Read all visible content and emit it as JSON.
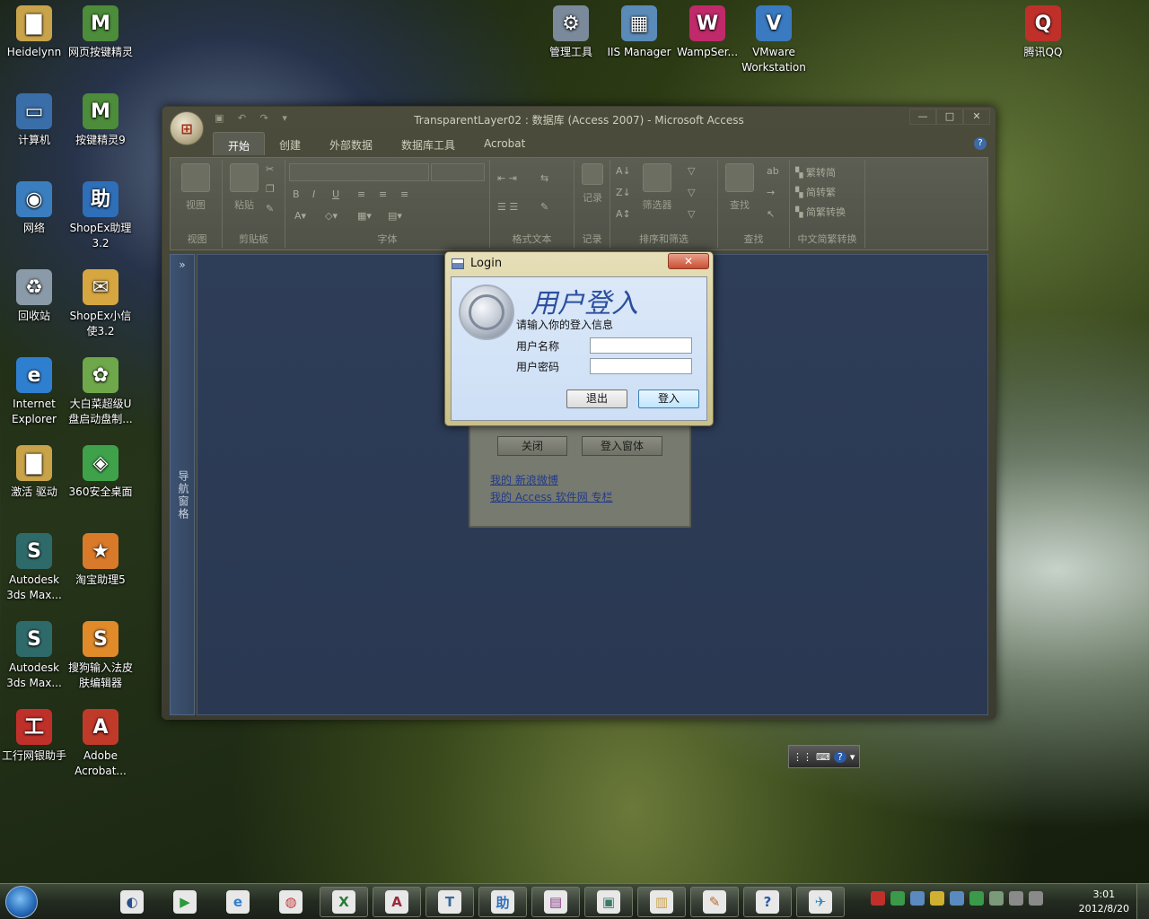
{
  "desktop": {
    "icons_left": [
      {
        "label": "Heidelynn",
        "name": "folder-icon",
        "glyph": "▇",
        "color": "#c9a34a"
      },
      {
        "label": "网页按键精灵",
        "name": "mouse-script-icon",
        "glyph": "M",
        "color": "#4c8c3a"
      },
      {
        "label": "计算机",
        "name": "computer-icon",
        "glyph": "▭",
        "color": "#3a6ea8"
      },
      {
        "label": "按键精灵9",
        "name": "mouse-script-icon",
        "glyph": "M",
        "color": "#4c8c3a"
      },
      {
        "label": "网络",
        "name": "network-icon",
        "glyph": "◉",
        "color": "#3a7ebf"
      },
      {
        "label": "ShopEx助理3.2",
        "name": "helper-icon",
        "glyph": "助",
        "color": "#2f6fb8"
      },
      {
        "label": "回收站",
        "name": "recycle-bin-icon",
        "glyph": "♻",
        "color": "#8a9aa8"
      },
      {
        "label": "ShopEx小信使3.2",
        "name": "messenger-icon",
        "glyph": "✉",
        "color": "#d6a640"
      },
      {
        "label": "Internet Explorer",
        "name": "internet-explorer-icon",
        "glyph": "e",
        "color": "#2f7fd0"
      },
      {
        "label": "大白菜超级U盘启动盘制...",
        "name": "usb-tool-icon",
        "glyph": "✿",
        "color": "#6fa84a"
      },
      {
        "label": "激活 驱动",
        "name": "folder-icon",
        "glyph": "▇",
        "color": "#c9a34a"
      },
      {
        "label": "360安全桌面",
        "name": "security-desktop-icon",
        "glyph": "◈",
        "color": "#3fa24a"
      },
      {
        "label": "Autodesk 3ds Max...",
        "name": "3ds-max-icon",
        "glyph": "S",
        "color": "#2f6a6a"
      },
      {
        "label": "淘宝助理5",
        "name": "taobao-helper-icon",
        "glyph": "★",
        "color": "#d87a2a"
      },
      {
        "label": "Autodesk 3ds Max...",
        "name": "3ds-max-icon",
        "glyph": "S",
        "color": "#2f6a6a"
      },
      {
        "label": "搜狗输入法皮肤编辑器",
        "name": "sogou-skin-icon",
        "glyph": "S",
        "color": "#e08a2a"
      },
      {
        "label": "工行网银助手",
        "name": "icbc-helper-icon",
        "glyph": "工",
        "color": "#c0302a"
      },
      {
        "label": "Adobe Acrobat...",
        "name": "acrobat-icon",
        "glyph": "A",
        "color": "#c03a2a"
      }
    ],
    "icons_top": [
      {
        "label": "管理工具",
        "name": "admin-tools-icon",
        "glyph": "⚙",
        "color": "#7a8a9a"
      },
      {
        "label": "IIS Manager",
        "name": "iis-manager-icon",
        "glyph": "▦",
        "color": "#5a8ab8"
      },
      {
        "label": "WampSer...",
        "name": "wampserver-icon",
        "glyph": "W",
        "color": "#c02a6a"
      },
      {
        "label": "VMware Workstation",
        "name": "vmware-icon",
        "glyph": "V",
        "color": "#3a7ac0"
      },
      {
        "label": "腾讯QQ",
        "name": "qq-icon",
        "glyph": "Q",
        "color": "#c0302a"
      }
    ]
  },
  "access_window": {
    "title": "TransparentLayer02 : 数据库 (Access 2007) - Microsoft Access",
    "controls": {
      "minimize": "—",
      "maximize": "□",
      "close": "✕"
    },
    "tabs": [
      "开始",
      "创建",
      "外部数据",
      "数据库工具",
      "Acrobat"
    ],
    "ribbon_groups": [
      "视图",
      "剪贴板",
      "字体",
      "格式文本",
      "记录",
      "排序和筛选",
      "查找",
      "中文简繁转换"
    ],
    "ribbon_buttons": {
      "view": "视图",
      "paste": "粘贴",
      "records": "记录",
      "filter": "筛选器",
      "find": "查找",
      "trad_to_simp": "繁转简",
      "simp_to_trad": "简转繁",
      "conversion": "简繁转换"
    },
    "nav_pane_label": "导航窗格",
    "nav_chevron": "»"
  },
  "background_form": {
    "close_button": "关闭",
    "login_window_button": "登入窗体",
    "links": [
      "我的 新浪微博",
      "我的 Access 软件网 专栏"
    ]
  },
  "login_dialog": {
    "title": "Login",
    "close": "✕",
    "heading": "用户登入",
    "subtitle": "请输入你的登入信息",
    "username_label": "用户名称",
    "password_label": "用户密码",
    "username_value": "",
    "password_value": "",
    "exit_button": "退出",
    "login_button": "登入"
  },
  "langbar": {
    "help": "?"
  },
  "taskbar": {
    "items": [
      {
        "name": "media-center-icon",
        "glyph": "◐",
        "color": "#2a4f8a"
      },
      {
        "name": "media-player-icon",
        "glyph": "▶",
        "color": "#2a9a3a"
      },
      {
        "name": "internet-explorer-icon",
        "glyph": "e",
        "color": "#2f7fd0"
      },
      {
        "name": "chrome-like-icon",
        "glyph": "◍",
        "color": "#c03a3a"
      },
      {
        "name": "excel-icon",
        "glyph": "X",
        "color": "#2a7a3a"
      },
      {
        "name": "access-icon",
        "glyph": "A",
        "color": "#9a2a3a"
      },
      {
        "name": "tool-icon",
        "glyph": "T",
        "color": "#3a6a9a"
      },
      {
        "name": "helper-icon",
        "glyph": "助",
        "color": "#2f6fb8"
      },
      {
        "name": "winrar-icon",
        "glyph": "▤",
        "color": "#8a3a8a"
      },
      {
        "name": "task-manager-icon",
        "glyph": "▣",
        "color": "#3a7a6a"
      },
      {
        "name": "file-explorer-icon",
        "glyph": "▥",
        "color": "#c9a34a"
      },
      {
        "name": "paint-icon",
        "glyph": "✎",
        "color": "#b86a2a"
      },
      {
        "name": "help-icon",
        "glyph": "?",
        "color": "#2a5aa8"
      },
      {
        "name": "feiq-icon",
        "glyph": "✈",
        "color": "#3a8ac0"
      }
    ],
    "tray_colors": [
      "#c0302a",
      "#3a9a4a",
      "#5a8ac0",
      "#d0b030",
      "#5a8ac0",
      "#3a9a4a",
      "#7a9a7a",
      "#8a8a8a",
      "#8a8a8a"
    ],
    "clock_time": "3:01",
    "clock_date": "2012/8/20"
  }
}
